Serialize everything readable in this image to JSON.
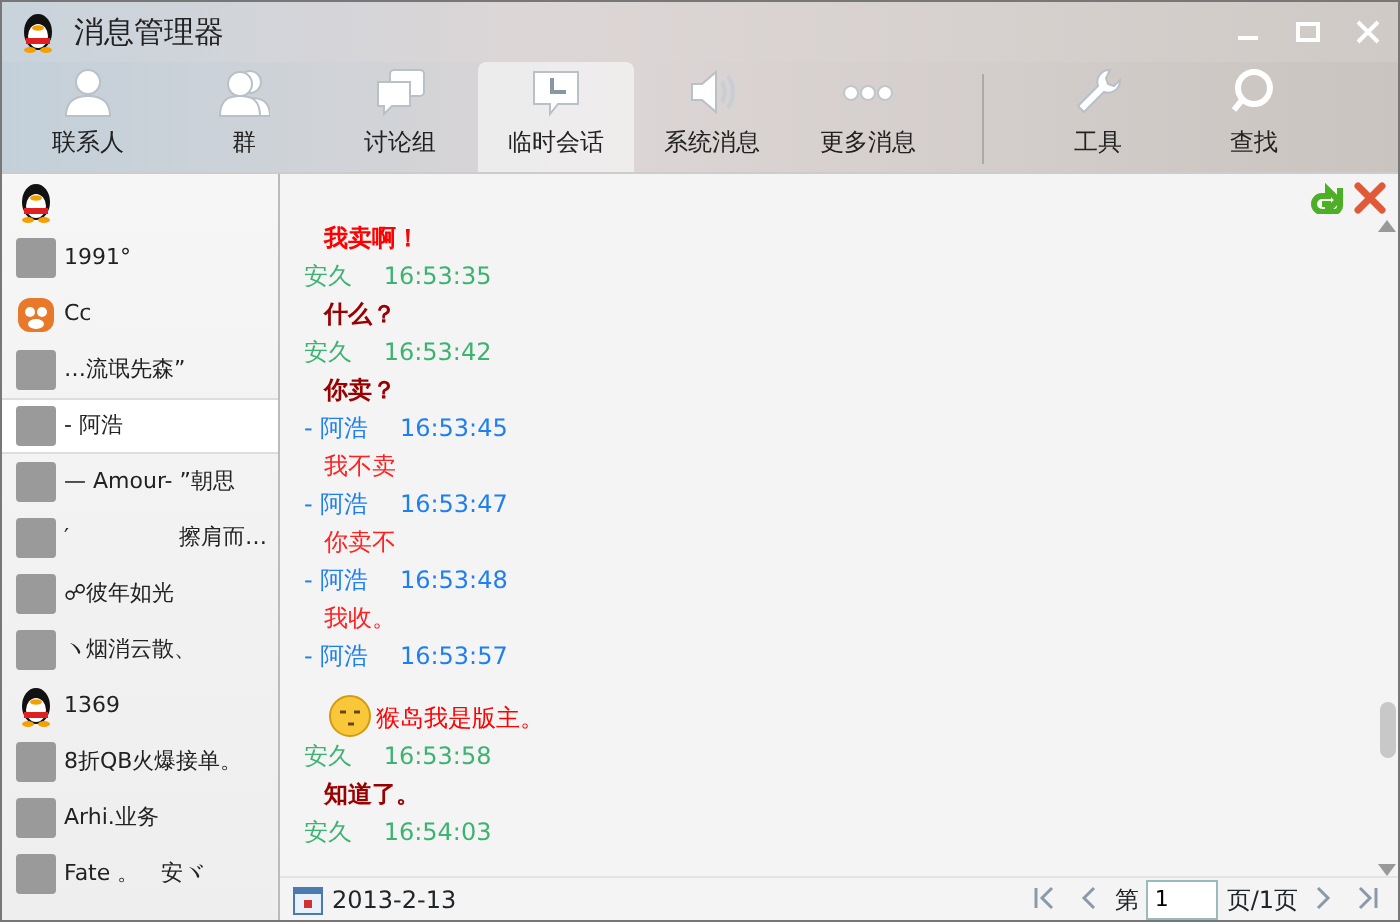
{
  "window": {
    "title": "消息管理器"
  },
  "tabs": [
    {
      "label": "联系人",
      "selected": false
    },
    {
      "label": "群",
      "selected": false
    },
    {
      "label": "讨论组",
      "selected": false
    },
    {
      "label": "临时会话",
      "selected": true
    },
    {
      "label": "系统消息",
      "selected": false
    },
    {
      "label": "更多消息",
      "selected": false
    }
  ],
  "tools": [
    {
      "label": "工具"
    },
    {
      "label": "查找"
    }
  ],
  "sidebar": {
    "items": [
      {
        "kind": "penguin",
        "selected": false
      },
      {
        "kind": "photo",
        "name": "1991°",
        "selected": false
      },
      {
        "kind": "tiger",
        "name": "Cc",
        "selected": false
      },
      {
        "kind": "photo",
        "name": "…流氓先森”",
        "selected": false
      },
      {
        "kind": "photo",
        "name": "- 阿浩",
        "selected": true
      },
      {
        "kind": "photo",
        "name": "— Amour- ”朝思",
        "selected": false
      },
      {
        "kind": "photo",
        "name": "′　　　　　擦肩而…",
        "selected": false
      },
      {
        "kind": "photo",
        "name": "☍彼年如光",
        "selected": false
      },
      {
        "kind": "photo",
        "name": "ヽ烟消云散、",
        "selected": false
      },
      {
        "kind": "penguin",
        "name": "1369",
        "selected": false
      },
      {
        "kind": "photo",
        "name": "8折QB火爆接单。",
        "selected": false
      },
      {
        "kind": "photo",
        "name": "Arhi.业务",
        "selected": false
      },
      {
        "kind": "photo",
        "name": "Fate 。　安ヾ",
        "selected": false
      }
    ]
  },
  "chat": {
    "messages": [
      {
        "kind": "text",
        "text": "我卖啊！",
        "bold": true,
        "color": "#ff0000"
      },
      {
        "kind": "header",
        "sender": "安久",
        "time": "16:53:35",
        "color": "#3cb371"
      },
      {
        "kind": "text",
        "text": "什么？",
        "bold": true,
        "color": "#990000"
      },
      {
        "kind": "header",
        "sender": "安久",
        "time": "16:53:42",
        "color": "#3cb371"
      },
      {
        "kind": "text",
        "text": "你卖？",
        "bold": true,
        "color": "#990000"
      },
      {
        "kind": "header",
        "sender": "- 阿浩",
        "time": "16:53:45",
        "color": "#1e7ff0"
      },
      {
        "kind": "text",
        "text": "我不卖",
        "bold": false,
        "color": "#ff2020"
      },
      {
        "kind": "header",
        "sender": "- 阿浩",
        "time": "16:53:47",
        "color": "#1e7ff0"
      },
      {
        "kind": "text",
        "text": "你卖不",
        "bold": false,
        "color": "#ff2020"
      },
      {
        "kind": "header",
        "sender": "- 阿浩",
        "time": "16:53:48",
        "color": "#1e7ff0"
      },
      {
        "kind": "text",
        "text": "我收。",
        "bold": false,
        "color": "#ff2020"
      },
      {
        "kind": "header",
        "sender": "- 阿浩",
        "time": "16:53:57",
        "color": "#1e7ff0"
      },
      {
        "kind": "emoji_text",
        "text": "猴岛我是版主。",
        "bold": false,
        "color": "#ff0000"
      },
      {
        "kind": "header",
        "sender": "安久",
        "time": "16:53:58",
        "color": "#3cb371"
      },
      {
        "kind": "text",
        "text": "知道了。",
        "bold": true,
        "color": "#990000"
      },
      {
        "kind": "header",
        "sender": "安久",
        "time": "16:54:03",
        "color": "#3cb371"
      }
    ]
  },
  "footer": {
    "date": "2013-2-13",
    "page_prefix": "第",
    "page": "1",
    "page_suffix": "页/1页"
  }
}
